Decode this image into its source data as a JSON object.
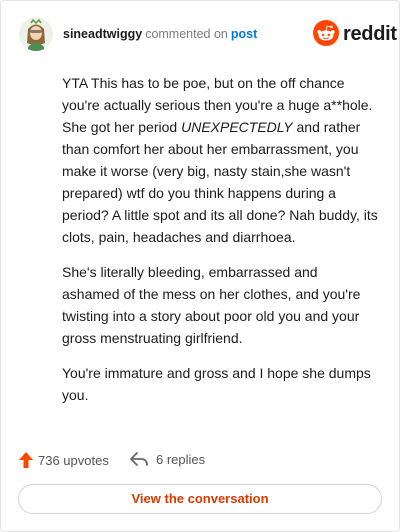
{
  "header": {
    "username": "sineadtwiggy",
    "action_text": "commented on",
    "post_link": "post",
    "brand_word": "reddit",
    "avatar_icon": "avatar-icon",
    "brand_icon": "reddit-logo-icon"
  },
  "comment": {
    "paragraph_1_before": "YTA This has to be poe, but on the off chance you're actually serious then you're a huge a**hole. She got her period ",
    "paragraph_1_emphasis": "UNEXPECTEDLY",
    "paragraph_1_after": " and rather than comfort her about her embarrassment, you make it worse (very big, nasty stain,she wasn't prepared) wtf do you think happens during a period? A little spot and its all done? Nah buddy, its clots, pain, headaches and diarrhoea.",
    "paragraph_2": "She's literally bleeding, embarrassed and ashamed of the mess on her clothes, and you're twisting into a story about poor old you and your gross menstruating girlfriend.",
    "paragraph_3": "You're immature and gross and I hope she dumps you."
  },
  "footer": {
    "upvotes": "736 upvotes",
    "replies": "6 replies",
    "upvote_icon": "upvote-arrow-icon",
    "reply_icon": "reply-arrow-icon",
    "view_conversation": "View the conversation"
  },
  "colors": {
    "reddit_orange": "#ff4500",
    "link_blue": "#0079d3",
    "cta_text": "#d93a00"
  }
}
